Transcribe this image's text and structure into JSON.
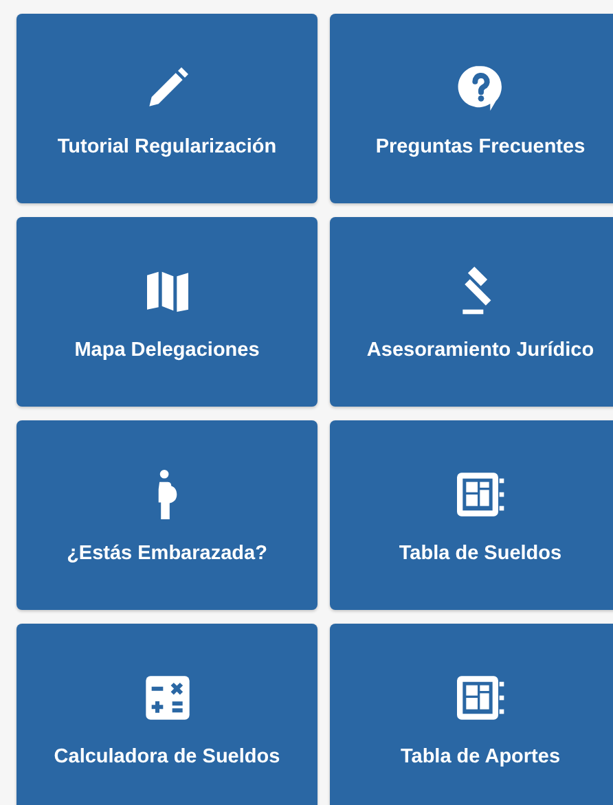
{
  "tiles": [
    {
      "label": "Tutorial Regularización",
      "kind": "pencil"
    },
    {
      "label": "Preguntas Frecuentes",
      "kind": "question"
    },
    {
      "label": "Mapa Delegaciones",
      "kind": "map"
    },
    {
      "label": "Asesoramiento Jurídico",
      "kind": "gavel"
    },
    {
      "label": "¿Estás Embarazada?",
      "kind": "pregnant"
    },
    {
      "label": "Tabla de Sueldos",
      "kind": "table"
    },
    {
      "label": "Calculadora de Sueldos",
      "kind": "calculator"
    },
    {
      "label": "Tabla de Aportes",
      "kind": "table"
    }
  ]
}
